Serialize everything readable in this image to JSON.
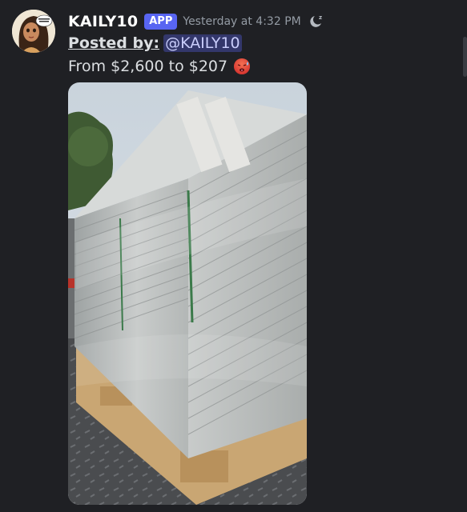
{
  "message": {
    "author": "KAILY10",
    "badge": "APP",
    "timestamp": "Yesterday at 4:32 PM",
    "posted_label": "Posted by:",
    "mention": "@KAILY10",
    "text": "From $2,600 to $207",
    "emoji": "hot-face-emoji",
    "status_icon": "dnd-sleep-icon",
    "attachment": "photo of shrink-wrapped stacked boards on wooden pallet"
  },
  "colors": {
    "background": "#1f2024",
    "badge": "#5865f2",
    "mention_bg": "#3d4270",
    "timestamp": "#949ba4"
  }
}
